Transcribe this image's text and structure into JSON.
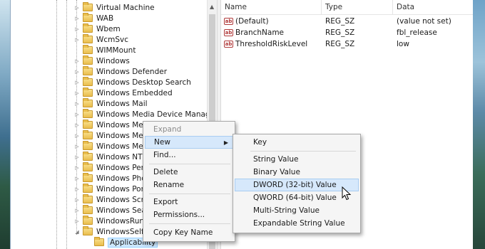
{
  "tree": {
    "items": [
      {
        "label": "Virtual Machine",
        "expander": "▷"
      },
      {
        "label": "WAB",
        "expander": "▷"
      },
      {
        "label": "Wbem",
        "expander": "▷"
      },
      {
        "label": "WcmSvc",
        "expander": "▷"
      },
      {
        "label": "WIMMount",
        "expander": ""
      },
      {
        "label": "Windows",
        "expander": "▷"
      },
      {
        "label": "Windows Defender",
        "expander": "▷"
      },
      {
        "label": "Windows Desktop Search",
        "expander": "▷"
      },
      {
        "label": "Windows Embedded",
        "expander": "▷"
      },
      {
        "label": "Windows Mail",
        "expander": "▷"
      },
      {
        "label": "Windows Media Device Manager",
        "expander": "▷"
      },
      {
        "label": "Windows Med",
        "expander": "▷"
      },
      {
        "label": "Windows Med",
        "expander": "▷"
      },
      {
        "label": "Windows Mes",
        "expander": "▷"
      },
      {
        "label": "Windows NT",
        "expander": "▷"
      },
      {
        "label": "Windows Perf",
        "expander": "▷"
      },
      {
        "label": "Windows Pho",
        "expander": "▷"
      },
      {
        "label": "Windows Port",
        "expander": "▷"
      },
      {
        "label": "Windows Scrip",
        "expander": "▷"
      },
      {
        "label": "Windows Sear",
        "expander": "▷"
      },
      {
        "label": "WindowsRunt",
        "expander": "▷"
      },
      {
        "label": "WindowsSelfH",
        "expander": "◢"
      },
      {
        "label": "Applicability",
        "expander": ""
      }
    ]
  },
  "values": {
    "columns": {
      "name": "Name",
      "type": "Type",
      "data": "Data"
    },
    "rows": [
      {
        "icon": "ab",
        "name": "(Default)",
        "type": "REG_SZ",
        "data": "(value not set)"
      },
      {
        "icon": "ab",
        "name": "BranchName",
        "type": "REG_SZ",
        "data": "fbl_release"
      },
      {
        "icon": "ab",
        "name": "ThresholdRiskLevel",
        "type": "REG_SZ",
        "data": "low"
      }
    ]
  },
  "context_menu": {
    "expand": "Expand",
    "new": "New",
    "find": "Find...",
    "delete": "Delete",
    "rename": "Rename",
    "export": "Export",
    "permissions": "Permissions...",
    "copy_key_name": "Copy Key Name"
  },
  "submenu": {
    "key": "Key",
    "string_value": "String Value",
    "binary_value": "Binary Value",
    "dword_value": "DWORD (32-bit) Value",
    "qword_value": "QWORD (64-bit) Value",
    "multi_string_value": "Multi-String Value",
    "expandable_string_value": "Expandable String Value"
  },
  "colors": {
    "highlight": "#d6e8fb",
    "selection": "#cde8ff",
    "folder": "#e9bd4c",
    "string_icon": "#b03a3a"
  }
}
